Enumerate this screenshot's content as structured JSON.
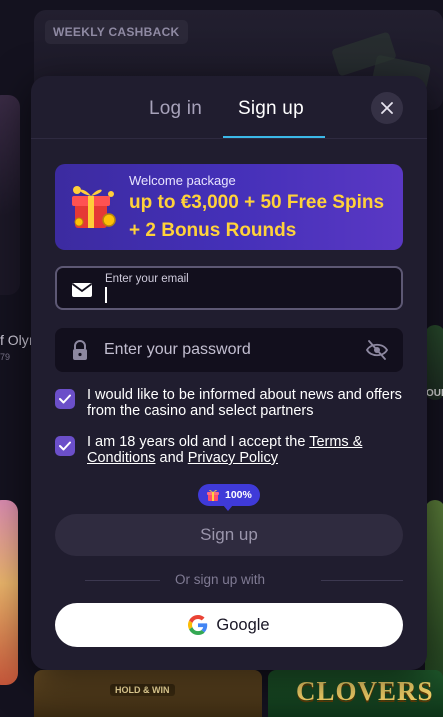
{
  "background": {
    "weekly_badge": "WEEKLY CASHBACK",
    "left_game_title": "f Olyı",
    "left_game_sub": "79",
    "right_game_text": "OUI",
    "bottom_game_label": "HOLD & WIN",
    "bottom_right_game_title": "CLOVERS"
  },
  "modal": {
    "tabs": [
      {
        "label": "Log in",
        "active": false
      },
      {
        "label": "Sign up",
        "active": true
      }
    ],
    "close_icon": "close-icon",
    "promo": {
      "small_text": "Welcome package",
      "headline": "up to €3,000 + 50 Free Spins + 2 Bonus Rounds",
      "icon": "gift-icon"
    },
    "email_field": {
      "label": "Enter your email",
      "value": "",
      "icon": "envelope-icon"
    },
    "password_field": {
      "placeholder": "Enter your password",
      "icon": "lock-icon",
      "toggle_icon": "eye-off-icon"
    },
    "checkboxes": [
      {
        "checked": true,
        "text": "I would like to be informed about news and offers from the casino and select partners"
      },
      {
        "checked": true,
        "text_prefix": "I am 18 years old and I accept the ",
        "link1": "Terms & Conditions",
        "text_mid": " and ",
        "link2": "Privacy Policy"
      }
    ],
    "bonus_badge": "100%",
    "signup_button": "Sign up",
    "divider_text": "Or sign up with",
    "google_button": "Google"
  },
  "colors": {
    "accent_blue": "#3bb8e8",
    "checkbox_purple": "#6b4fc9",
    "promo_yellow": "#ffd23a",
    "badge_blue": "#3f3ad8"
  }
}
